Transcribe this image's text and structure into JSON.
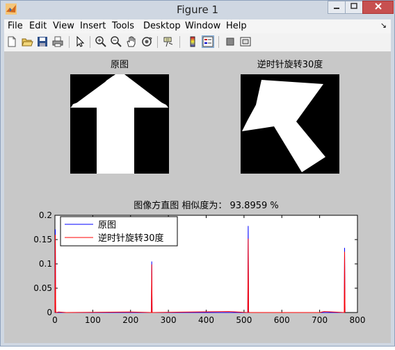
{
  "window": {
    "title": "Figure 1",
    "icon": "matlab-logo"
  },
  "menu": [
    "File",
    "Edit",
    "View",
    "Insert",
    "Tools",
    "Desktop",
    "Window",
    "Help"
  ],
  "menu_dock_glyph": "↘",
  "toolbar": [
    "new-figure-icon",
    "open-icon",
    "save-icon",
    "print-icon",
    "pointer-icon",
    "zoom-in-icon",
    "zoom-out-icon",
    "pan-hand-icon",
    "rotate-3d-icon",
    "data-cursor-icon",
    "colorbar-icon",
    "legend-icon",
    "hide-plot-tools-icon",
    "show-plot-tools-icon"
  ],
  "axes_original": {
    "title": "原图"
  },
  "axes_rotated": {
    "title": "逆时针旋转30度"
  },
  "histogram": {
    "title": "图像方直图  相似度为： 93.8959 %",
    "xticks": [
      "0",
      "100",
      "200",
      "300",
      "400",
      "500",
      "600",
      "700",
      "800"
    ],
    "yticks": [
      "0",
      "0.05",
      "0.1",
      "0.15",
      "0.2"
    ],
    "legend": [
      "原图",
      "逆时针旋转30度"
    ]
  },
  "colors": {
    "series1": "#0000ff",
    "series2": "#ff0000",
    "figure_bg": "#c8c8c8"
  },
  "chart_data": {
    "type": "line",
    "xlim": [
      0,
      800
    ],
    "ylim": [
      0,
      0.2
    ],
    "series": [
      {
        "name": "原图",
        "x": [
          0,
          1,
          2,
          3,
          10,
          255,
          256,
          257,
          510,
          511,
          512,
          513,
          765,
          766,
          767
        ],
        "y": [
          0,
          0.171,
          0,
          0,
          0,
          0,
          0.105,
          0,
          0,
          0.178,
          0,
          0,
          0,
          0.133,
          0
        ]
      },
      {
        "name": "逆时针旋转30度",
        "x": [
          0,
          1,
          2,
          3,
          10,
          30,
          200,
          255,
          256,
          257,
          460,
          510,
          511,
          512,
          513,
          700,
          712,
          765,
          766,
          767
        ],
        "y": [
          0,
          0.16,
          0.002,
          0,
          0.001,
          0,
          0.001,
          0,
          0.099,
          0,
          0.002,
          0,
          0.152,
          0.003,
          0,
          0,
          0.002,
          0,
          0.125,
          0
        ]
      }
    ]
  }
}
